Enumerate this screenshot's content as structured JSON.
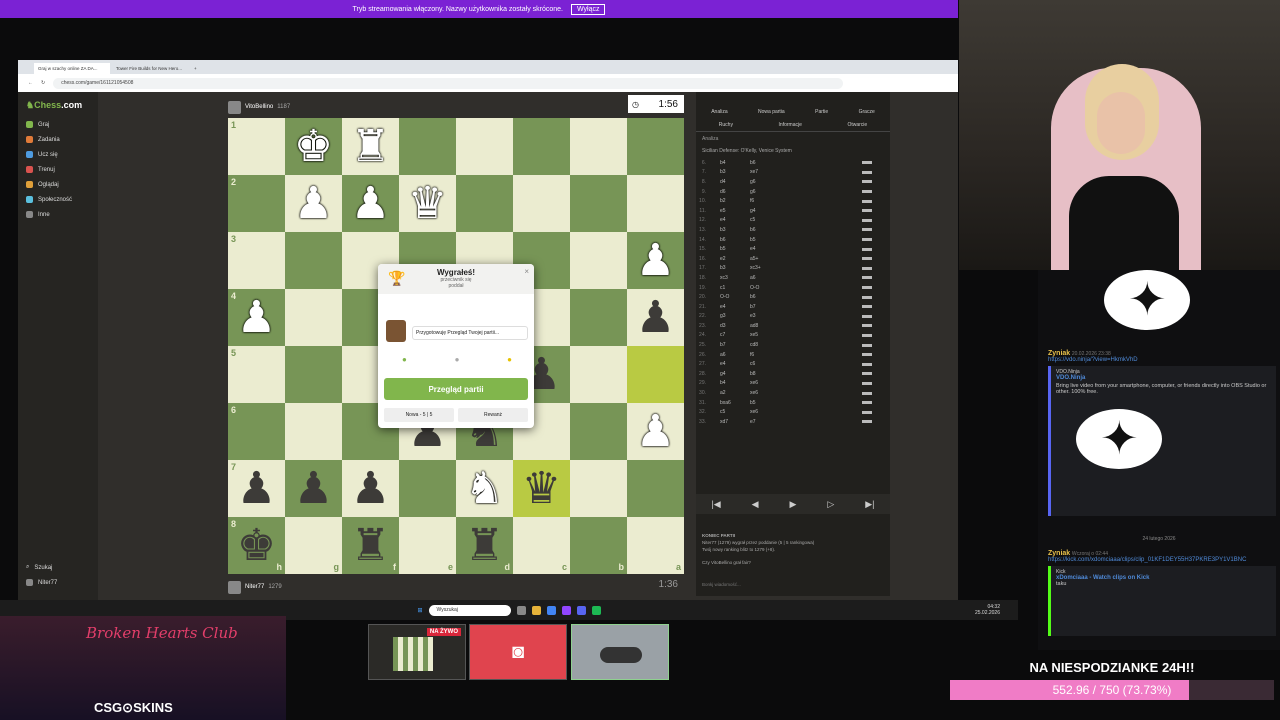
{
  "stream_bar": {
    "text": "Tryb streamowania włączony. Nazwy użytkownika zostały skrócone.",
    "button": "Wyłącz"
  },
  "browser": {
    "tabs": [
      "Graj w szachy online ZA DA...",
      "Tower Fire Builds for New Hero..."
    ],
    "url": "chess.com/game/161121054508"
  },
  "sidebar": {
    "logo_prefix": "♞",
    "logo": "Chess",
    "logo_suffix": ".com",
    "items": [
      {
        "label": "Graj",
        "color": "#81b64c"
      },
      {
        "label": "Zadania",
        "color": "#e07b39"
      },
      {
        "label": "Ucz się",
        "color": "#4e9be0"
      },
      {
        "label": "Trenuj",
        "color": "#d9534f"
      },
      {
        "label": "Oglądaj",
        "color": "#e0a03a"
      },
      {
        "label": "Społeczność",
        "color": "#5bc0de"
      },
      {
        "label": "Inne",
        "color": "#888888"
      }
    ],
    "bottom": [
      "Szukaj",
      "Niter77"
    ]
  },
  "top_player": {
    "name": "VitoBellino",
    "rating": "1187",
    "clock": "1:56"
  },
  "bottom_player": {
    "name": "Niter77",
    "rating": "1279",
    "clock": "1:36"
  },
  "board": {
    "ranks": [
      "1",
      "2",
      "3",
      "4",
      "5",
      "6",
      "7",
      "8"
    ],
    "files": [
      "h",
      "g",
      "f",
      "e",
      "d",
      "c",
      "b",
      "a"
    ],
    "rows": [
      [
        [
          "l",
          ""
        ],
        [
          "d",
          "wK"
        ],
        [
          "l",
          "wR"
        ],
        [
          "d",
          ""
        ],
        [
          "l",
          ""
        ],
        [
          "d",
          ""
        ],
        [
          "l",
          ""
        ],
        [
          "d",
          ""
        ]
      ],
      [
        [
          "d",
          ""
        ],
        [
          "l",
          "wP"
        ],
        [
          "d",
          "wP"
        ],
        [
          "l",
          "wQ"
        ],
        [
          "d",
          ""
        ],
        [
          "l",
          ""
        ],
        [
          "d",
          ""
        ],
        [
          "l",
          ""
        ]
      ],
      [
        [
          "l",
          ""
        ],
        [
          "d",
          ""
        ],
        [
          "l",
          ""
        ],
        [
          "d",
          ""
        ],
        [
          "l",
          ""
        ],
        [
          "d",
          ""
        ],
        [
          "l",
          ""
        ],
        [
          "d",
          "wP"
        ]
      ],
      [
        [
          "d",
          "wP"
        ],
        [
          "l",
          ""
        ],
        [
          "d",
          ""
        ],
        [
          "l",
          ""
        ],
        [
          "d",
          ""
        ],
        [
          "l",
          ""
        ],
        [
          "d",
          ""
        ],
        [
          "l",
          "bP"
        ]
      ],
      [
        [
          "l",
          ""
        ],
        [
          "d",
          ""
        ],
        [
          "l",
          ""
        ],
        [
          "d",
          ""
        ],
        [
          "l",
          ""
        ],
        [
          "d",
          "bP"
        ],
        [
          "l",
          ""
        ],
        [
          "h",
          ""
        ]
      ],
      [
        [
          "d",
          ""
        ],
        [
          "l",
          ""
        ],
        [
          "d",
          ""
        ],
        [
          "l",
          "bP"
        ],
        [
          "d",
          "bN"
        ],
        [
          "l",
          ""
        ],
        [
          "d",
          ""
        ],
        [
          "l",
          "wP"
        ]
      ],
      [
        [
          "l",
          "bP"
        ],
        [
          "d",
          "bP"
        ],
        [
          "l",
          "bP"
        ],
        [
          "d",
          ""
        ],
        [
          "l",
          "wN"
        ],
        [
          "h",
          "bQ"
        ],
        [
          "l",
          ""
        ],
        [
          "d",
          ""
        ]
      ],
      [
        [
          "d",
          "bK"
        ],
        [
          "l",
          ""
        ],
        [
          "d",
          "bR"
        ],
        [
          "l",
          ""
        ],
        [
          "d",
          "bR"
        ],
        [
          "l",
          ""
        ],
        [
          "d",
          ""
        ],
        [
          "l",
          ""
        ]
      ]
    ]
  },
  "modal": {
    "title": "Wygrałeś!",
    "subtitle_1": "przeciwnik się",
    "subtitle_2": "poddał",
    "coach_text": "Przygotowuję Przegląd Twojej partii...",
    "review_button": "Przegląd partii",
    "new_button": "Nowa - 5 | 5",
    "rematch_button": "Rewanż",
    "close": "×"
  },
  "panel": {
    "tabs": [
      "Analiza",
      "Nowa partia",
      "Partie",
      "Gracze"
    ],
    "subtabs": [
      "Ruchy",
      "Informacje",
      "Otwarcie"
    ],
    "engine_line": "Analiza",
    "opening": "Sicilian Defense: O'Kelly, Venice System",
    "moves": [
      [
        "6.",
        "b4",
        "b6"
      ],
      [
        "7.",
        "b3",
        "xe7"
      ],
      [
        "8.",
        "d4",
        "g6"
      ],
      [
        "9.",
        "d6",
        "g6"
      ],
      [
        "10.",
        "b2",
        "f6"
      ],
      [
        "11.",
        "e5",
        "g4"
      ],
      [
        "12.",
        "e4",
        "c5"
      ],
      [
        "13.",
        "b3",
        "b6"
      ],
      [
        "14.",
        "b6",
        "b5"
      ],
      [
        "15.",
        "b5",
        "e4"
      ],
      [
        "16.",
        "e2",
        "a5+"
      ],
      [
        "17.",
        "b3",
        "xc3+"
      ],
      [
        "18.",
        "xc3",
        "a6"
      ],
      [
        "19.",
        "c1",
        "O-O"
      ],
      [
        "20.",
        "O-O",
        "b6"
      ],
      [
        "21.",
        "e4",
        "b7"
      ],
      [
        "22.",
        "g3",
        "e3"
      ],
      [
        "23.",
        "d3",
        "ad8"
      ],
      [
        "24.",
        "c7",
        "xe5"
      ],
      [
        "25.",
        "b7",
        "cd8"
      ],
      [
        "26.",
        "a6",
        "f6"
      ],
      [
        "27.",
        "e4",
        "c6"
      ],
      [
        "28.",
        "g4",
        "b8"
      ],
      [
        "29.",
        "b4",
        "xe6"
      ],
      [
        "30.",
        "a2",
        "xe6"
      ],
      [
        "31.",
        "bxa6",
        "b5"
      ],
      [
        "32.",
        "c5",
        "xe6"
      ],
      [
        "33.",
        "xd7",
        "e7"
      ]
    ],
    "game_over_title": "KONIEC PARTII",
    "game_over_line": "Niter77 (1279) wygrał przez poddanie (5 | 5 rankingowa)",
    "rating_line": "Twój nowy ranking blitz to 1279 (+8).",
    "question": "Czy VitoBellino grał fair?",
    "chat_placeholder": "Bonkj wiadomość...",
    "controls": [
      "|◀",
      "◀",
      "▶",
      "▷",
      "▶|"
    ]
  },
  "taskbar": {
    "search": "Wyszukaj",
    "time": "04:32",
    "date": "25.02.2026"
  },
  "chat": {
    "msg1_user": "Zyniak",
    "msg1_time": "20.02.2026 23:38",
    "msg1_link": "https://vdo.ninja/?view=HkmkVhD",
    "embed1_site": "VDO.Ninja",
    "embed1_title": "VDO.Ninja",
    "embed1_desc": "Bring live video from your smartphone, computer, or friends directly into OBS Studio or other. 100% free.",
    "date_sep": "24 lutego 2026",
    "msg2_user": "Zyniak",
    "msg2_time": "Wczoraj o 02:44",
    "msg2_link": "https://kick.com/xdomciaaa/clips/clip_01KF1DEY55H37PKRE3PY1V1BNC",
    "embed2_site": "Kick",
    "embed2_title": "xDomciaaa - Watch clips on Kick",
    "embed2_desc": "taku"
  },
  "overlay": {
    "ad_title": "Broken Hearts Club",
    "ad_brand": "CSG⊙SKINS",
    "thumb_live": "NA ŻYWO",
    "goal_label": "NA NIESPODZIANKE 24H!!",
    "goal_value": "552.96 / 750 (73.73%)",
    "goal_fraction": 0.7373,
    "discord_color": "#e0444e"
  }
}
